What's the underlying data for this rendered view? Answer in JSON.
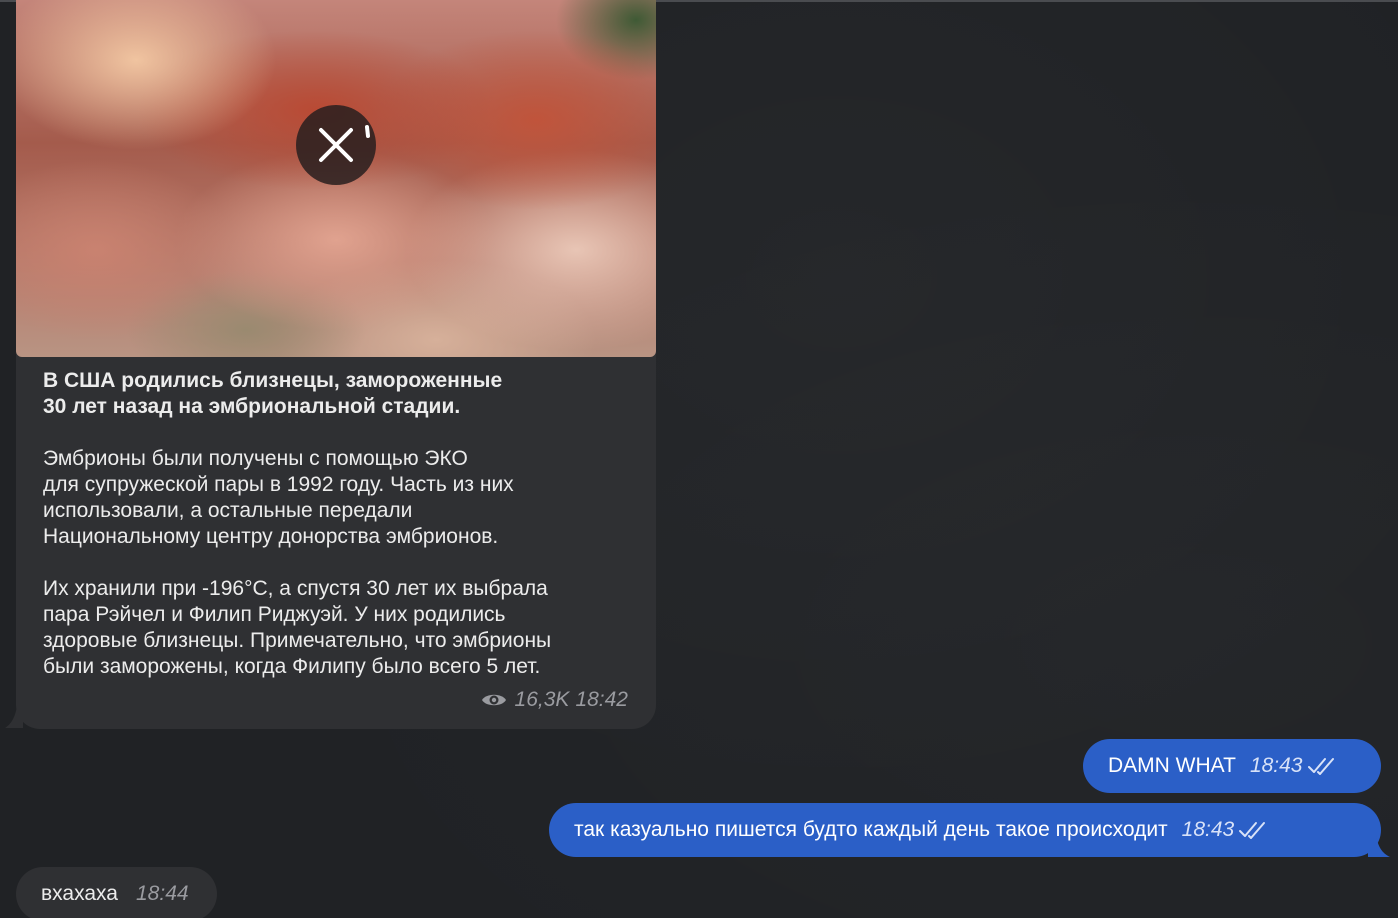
{
  "messages": {
    "post": {
      "title": "В США родились близнецы, замороженные\n30 лет назад на эмбриональной стадии.",
      "paragraph_1": "Эмбрионы были получены с помощью ЭКО\nдля супружеской пары в 1992 году. Часть из них\nиспользовали, а остальные передали\nНациональному центру донорства эмбрионов.",
      "paragraph_2": "Их хранили при -196°C, а спустя 30 лет их выбрала\nпара Рэйчел и Филип Риджуэй. У них родились\nздоровые близнецы. Примечательно, что эмбрионы\nбыли заморожены, когда Филипу было всего 5 лет.",
      "views": "16,3K",
      "time": "18:42",
      "media_icon": "cancel-download-icon"
    },
    "outgoing_1": {
      "text": "DAMN WHAT",
      "time": "18:43",
      "status_icon": "double-check-icon"
    },
    "outgoing_2": {
      "text": "так казуально пишется будто каждый день такое происходит",
      "time": "18:43",
      "status_icon": "double-check-icon"
    },
    "incoming_reply": {
      "text": "вхахаха",
      "time": "18:44"
    }
  },
  "colors": {
    "background": "#202225",
    "incoming_bubble": "#2f3033",
    "outgoing_bubble": "#2b5fc7",
    "meta_text": "#9a9ba0"
  }
}
